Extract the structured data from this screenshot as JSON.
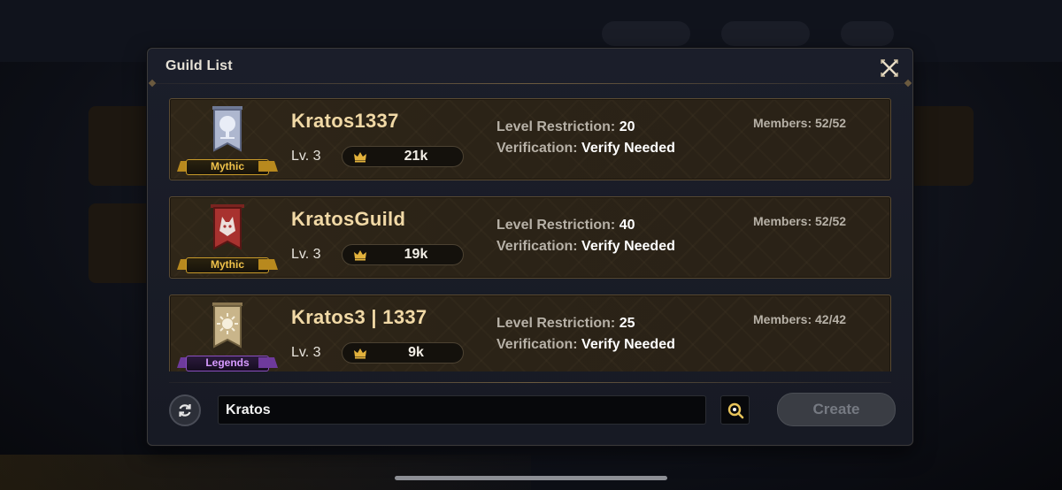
{
  "modal": {
    "title": "Guild List"
  },
  "guilds": [
    {
      "name": "Kratos1337",
      "rank": "Mythic",
      "level": "Lv. 3",
      "power": "21k",
      "level_restriction_label": "Level Restriction:",
      "level_restriction": "20",
      "verification_label": "Verification:",
      "verification": "Verify Needed",
      "members": "Members: 52/52",
      "emblem_icon": "white-tree-banner-icon",
      "emblem_color": "#aeb7cf"
    },
    {
      "name": "KratosGuild",
      "rank": "Mythic",
      "level": "Lv. 3",
      "power": "19k",
      "level_restriction_label": "Level Restriction:",
      "level_restriction": "40",
      "verification_label": "Verification:",
      "verification": "Verify Needed",
      "members": "Members: 52/52",
      "emblem_icon": "wolf-banner-icon",
      "emblem_color": "#a8322f"
    },
    {
      "name": "Kratos3 | 1337",
      "rank": "Legends",
      "level": "Lv. 3",
      "power": "9k",
      "level_restriction_label": "Level Restriction:",
      "level_restriction": "25",
      "verification_label": "Verification:",
      "verification": "Verify Needed",
      "members": "Members: 42/42",
      "emblem_icon": "sun-banner-icon",
      "emblem_color": "#c9b58a"
    }
  ],
  "footer": {
    "search_value": "Kratos",
    "create_label": "Create"
  },
  "colors": {
    "mythic": "#f0c24a",
    "legends": "#d79bff",
    "guild_name": "#f1d9a6",
    "create_disabled": "#3a3d44"
  }
}
